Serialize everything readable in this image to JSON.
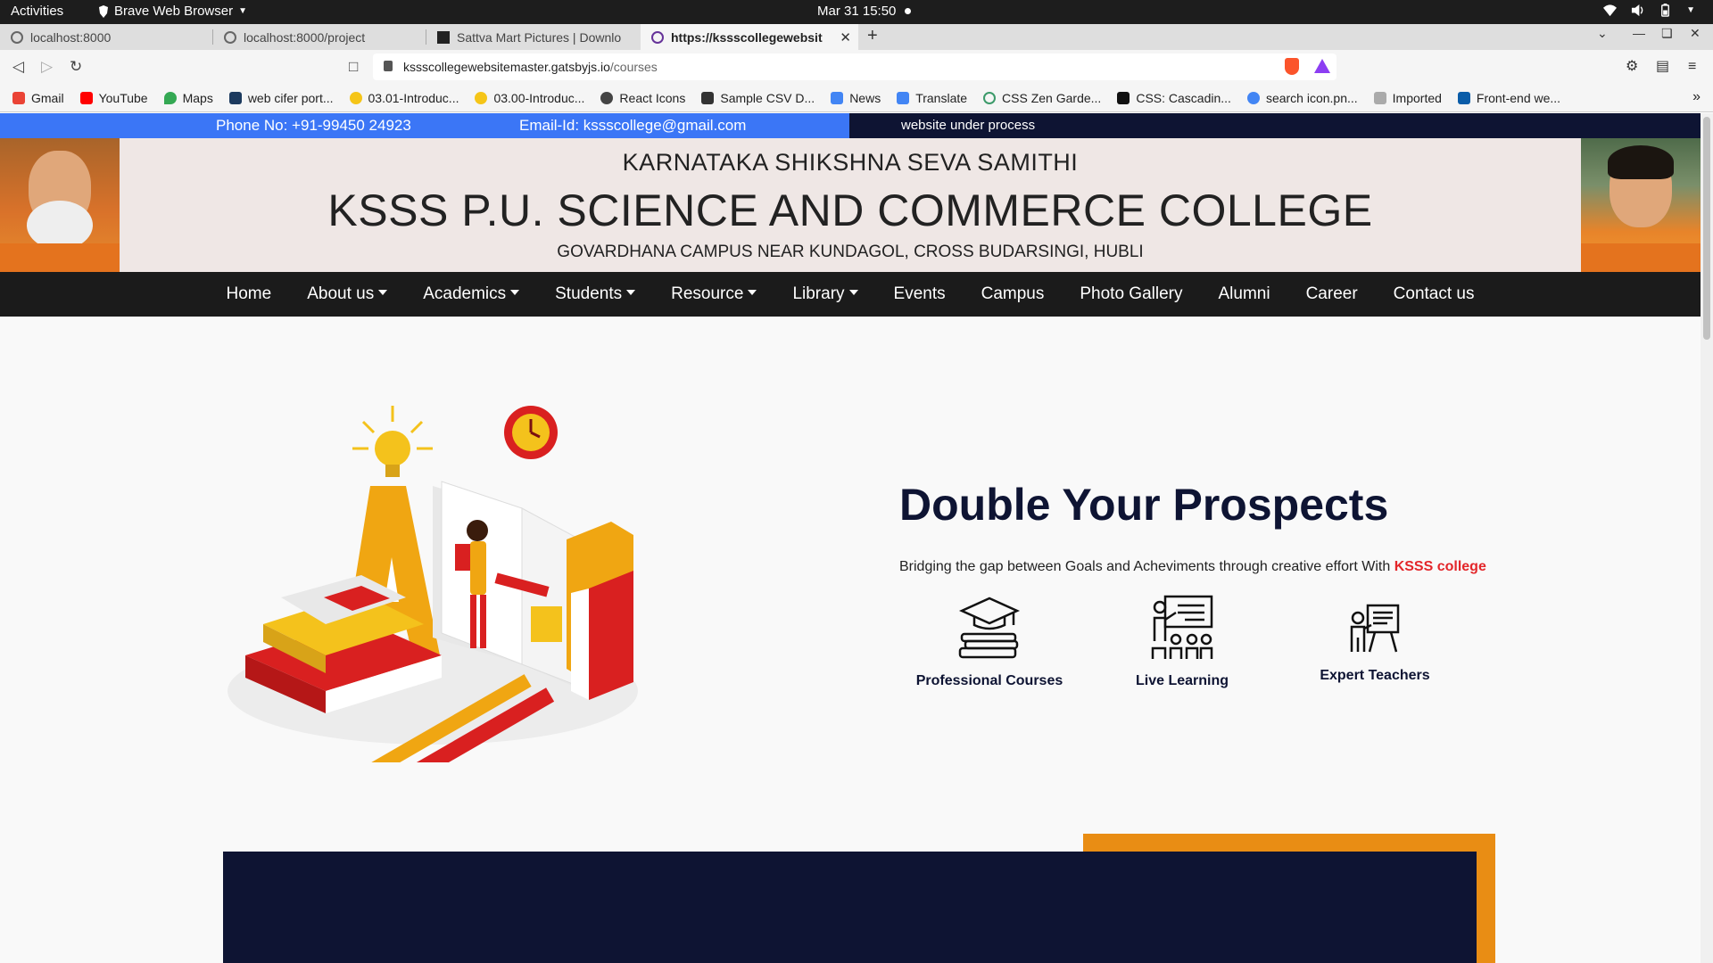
{
  "system": {
    "activities": "Activities",
    "app_name": "Brave Web Browser",
    "clock": "Mar 31  15:50"
  },
  "tabs": [
    {
      "label": "localhost:8000"
    },
    {
      "label": "localhost:8000/project"
    },
    {
      "label": "Sattva Mart Pictures | Downlo"
    },
    {
      "label": "https://kssscollegewebsit"
    }
  ],
  "address_bar": {
    "host": "kssscollegewebsitemaster.gatsbyjs.io",
    "path": "/courses"
  },
  "bookmarks": [
    {
      "label": "Gmail",
      "color": "#ea4335"
    },
    {
      "label": "YouTube",
      "color": "#ff0000"
    },
    {
      "label": "Maps",
      "color": "#34a853"
    },
    {
      "label": "web cifer port...",
      "color": "#1c3a5e"
    },
    {
      "label": "03.01-Introduc...",
      "color": "#f5c518"
    },
    {
      "label": "03.00-Introduc...",
      "color": "#f5c518"
    },
    {
      "label": "React Icons",
      "color": "#444444"
    },
    {
      "label": "Sample CSV D...",
      "color": "#333333"
    },
    {
      "label": "News",
      "color": "#4285f4"
    },
    {
      "label": "Translate",
      "color": "#4285f4"
    },
    {
      "label": "CSS Zen Garde...",
      "color": "#3c9a6a"
    },
    {
      "label": "CSS: Cascadin...",
      "color": "#111111"
    },
    {
      "label": "search icon.pn...",
      "color": "#4285f4"
    },
    {
      "label": "Imported",
      "color": "#aaaaaa"
    },
    {
      "label": "Front-end we...",
      "color": "#0a5ca8"
    }
  ],
  "infobar": {
    "phone": "Phone No: +91-99450 24923",
    "email": "Email-Id: kssscollege@gmail.com",
    "notice": "website under process"
  },
  "header": {
    "org": "KARNATAKA SHIKSHNA SEVA SAMITHI",
    "college": "KSSS P.U. SCIENCE AND COMMERCE COLLEGE",
    "address": "GOVARDHANA CAMPUS NEAR KUNDAGOL, CROSS BUDARSINGI, HUBLI"
  },
  "nav": {
    "home": "Home",
    "about": "About us",
    "academics": "Academics",
    "students": "Students",
    "resource": "Resource",
    "library": "Library",
    "events": "Events",
    "campus": "Campus",
    "gallery": "Photo Gallery",
    "alumni": "Alumni",
    "career": "Career",
    "contact": "Contact us"
  },
  "hero": {
    "title": "Double Your Prospects",
    "text": "Bridging the gap between Goals and Acheviments through creative effort With ",
    "brand": "KSSS college"
  },
  "features": [
    {
      "label": "Professional Courses",
      "icon": "graduation-books-icon"
    },
    {
      "label": "Live Learning",
      "icon": "classroom-icon"
    },
    {
      "label": "Expert Teachers",
      "icon": "teacher-board-icon"
    }
  ],
  "colors": {
    "navy": "#0e1433",
    "accent_red": "#e3262a",
    "accent_orange": "#e98d14",
    "info_blue": "#3b76f6"
  }
}
